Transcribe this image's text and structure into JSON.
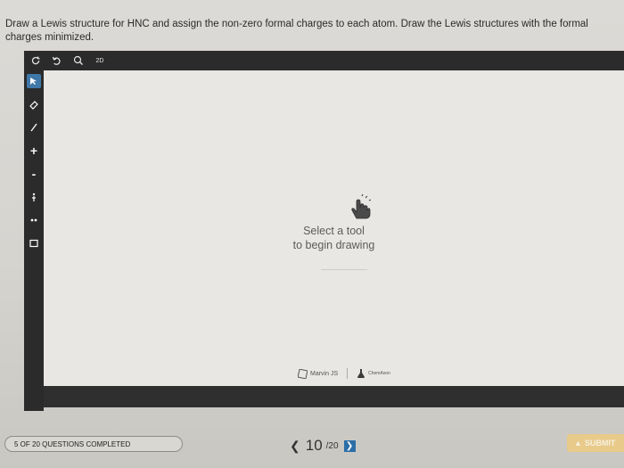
{
  "question": {
    "text": "Draw a Lewis structure for HNC and assign the non-zero formal charges to each atom. Draw the Lewis structures with the formal charges minimized."
  },
  "editor": {
    "top_toolbar": [
      {
        "icon": "undo-icon"
      },
      {
        "icon": "redo-icon"
      },
      {
        "icon": "zoom-icon"
      },
      {
        "icon": "clean-2d-icon",
        "label": "2D"
      }
    ],
    "left_toolbar": [
      {
        "icon": "select-arrow-icon",
        "active": true
      },
      {
        "icon": "eraser-icon"
      },
      {
        "icon": "bond-line-icon"
      },
      {
        "icon": "plus-charge-icon",
        "label": "+"
      },
      {
        "icon": "minus-charge-icon",
        "label": "-"
      },
      {
        "icon": "lone-pair-icon"
      },
      {
        "icon": "radical-icon"
      },
      {
        "icon": "rectangle-icon"
      }
    ],
    "canvas_hint": {
      "line1": "Select a tool",
      "line2": "to begin drawing"
    },
    "footer_logos": {
      "marvin": "Marvin JS",
      "chemaxon": "ChemAxon"
    }
  },
  "footer": {
    "progress_text": "5 OF 20 QUESTIONS COMPLETED",
    "pager": {
      "current": "10",
      "total": "/20"
    },
    "submit_label": "SUBMIT"
  }
}
